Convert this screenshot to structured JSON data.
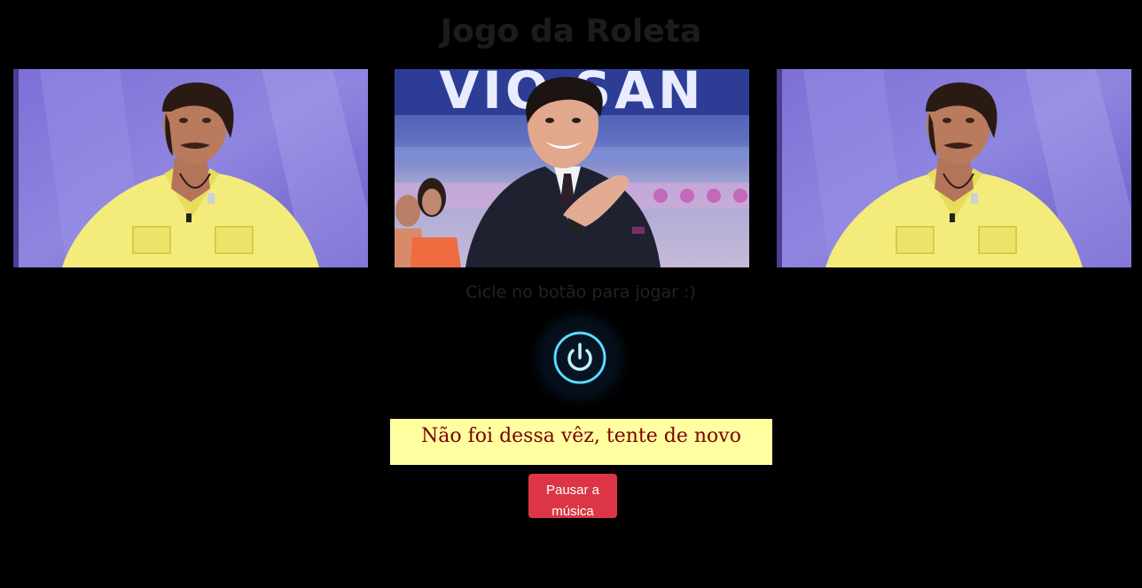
{
  "page": {
    "title": "Jogo da Roleta",
    "hint": "Cicle no botão para jogar :)",
    "result": "Não foi dessa vêz, tente de novo",
    "music_button_label": "Pausar a música"
  },
  "slots": [
    {
      "name": "slot-1",
      "image": "host-yellow-shirt-photo"
    },
    {
      "name": "slot-2",
      "image": "host-suit-smiling-photo",
      "banner_text": "VIO SAN"
    },
    {
      "name": "slot-3",
      "image": "host-yellow-shirt-photo"
    }
  ],
  "icons": {
    "spin": "power-icon"
  },
  "colors": {
    "background": "#000000",
    "title": "#1c1c1c",
    "result_bg": "#ffffa0",
    "result_text": "#7a0000",
    "button_bg": "#dc3545",
    "power_glow": "#3fd0ff"
  }
}
